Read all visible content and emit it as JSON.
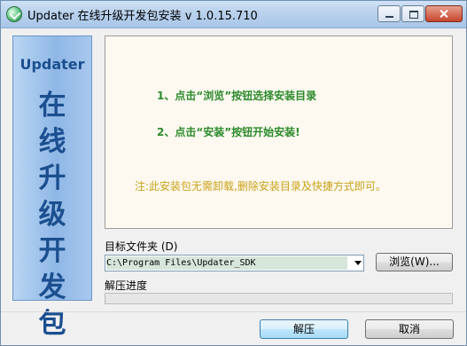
{
  "window": {
    "title": "Updater 在线升级开发包安装 v 1.0.15.710"
  },
  "sidebar": {
    "logo": "Updater",
    "chars": [
      "在",
      "线",
      "升",
      "级",
      "开",
      "发",
      "包"
    ]
  },
  "info": {
    "step1": "1、点击“浏览”按钮选择安装目录",
    "step2": "2、点击“安装”按钮开始安装!",
    "note": "注:此安装包无需卸载,删除安装目录及快捷方式即可。"
  },
  "target_folder": {
    "label": "目标文件夹 (D)",
    "value": "C:\\Program Files\\Updater_SDK",
    "browse_label": "浏览(W)..."
  },
  "progress": {
    "label": "解压进度",
    "value": 0
  },
  "buttons": {
    "extract_label": "解压",
    "cancel_label": "取消"
  },
  "colors": {
    "step_text": "#2b8a2b",
    "note_text": "#c9a21a",
    "sidebar_text": "#1b4f8f",
    "info_panel_bg": "#fdf9f0"
  },
  "icons": {
    "app": "updater-app-icon",
    "minimize": "minimize-icon",
    "maximize": "maximize-icon",
    "close": "close-icon",
    "dropdown": "chevron-down-icon"
  }
}
